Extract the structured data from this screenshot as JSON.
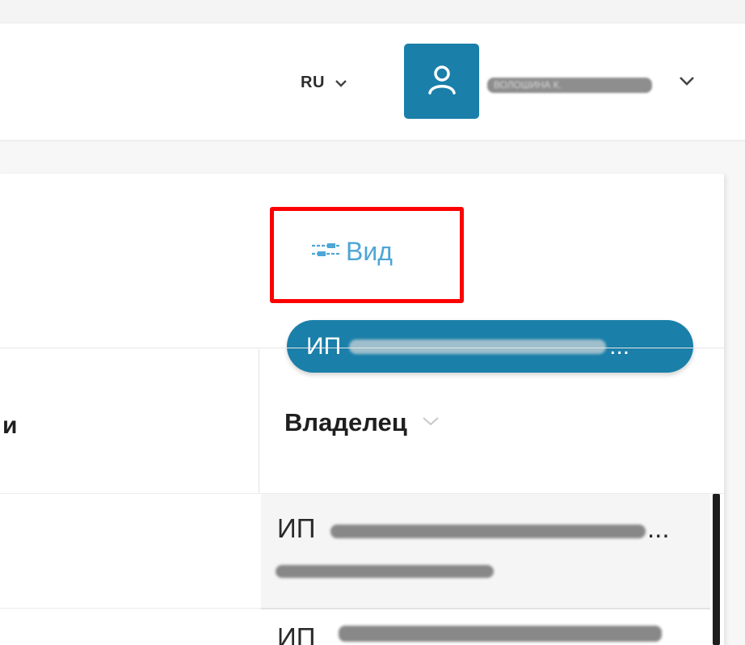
{
  "header": {
    "language": {
      "label": "RU",
      "icon": "chevron-down-icon"
    },
    "user": {
      "avatar_icon": "user-icon",
      "name": "ВОЛОШИНА К.",
      "menu_icon": "chevron-down-icon"
    }
  },
  "toolbar": {
    "view_label": "Вид",
    "view_icon": "sliders-icon"
  },
  "company_selector": {
    "prefix": "ИП",
    "ellipsis": "..."
  },
  "table": {
    "left_column_header": "и",
    "owner_column_header": "Владелец",
    "sort_icon": "chevron-down-icon",
    "rows": [
      {
        "owner_prefix": "ИП",
        "owner_ellipsis": "..."
      },
      {
        "owner_prefix": "ИП"
      }
    ]
  },
  "colors": {
    "accent": "#1a7fa9",
    "link": "#4da6d6",
    "highlight": "#ff0000"
  }
}
